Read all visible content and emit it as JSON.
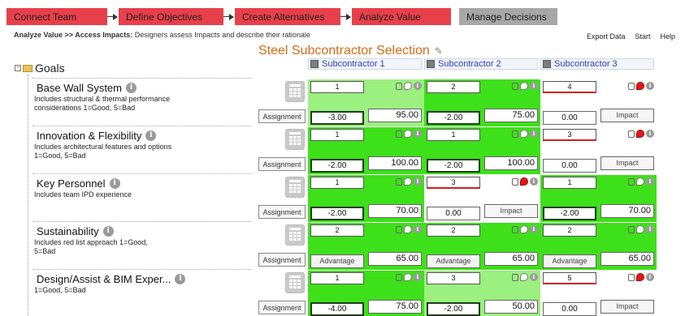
{
  "workflow": {
    "steps": [
      {
        "label": "Connect Team",
        "state": "active"
      },
      {
        "label": "Define Objectives",
        "state": "active"
      },
      {
        "label": "Create Alternatives",
        "state": "active"
      },
      {
        "label": "Analyze Value",
        "state": "active"
      },
      {
        "label": "Manage Decisions",
        "state": "inactive"
      }
    ]
  },
  "breadcrumb": {
    "path": "Analyze Value >> Access Impacts:",
    "description": "Designers assess Impacts and describe their rationale"
  },
  "top_links": [
    "Export Data",
    "Start",
    "Help"
  ],
  "title": "Steel Subcontractor Selection",
  "subcontractors": [
    "Subcontractor 1",
    "Subcontractor 2",
    "Subcontractor 3"
  ],
  "goals_header": "Goals",
  "assignment_label": "Assignment",
  "colors": {
    "accent_orange": "#d56b17",
    "step_red": "#e8404b",
    "green": "#3ee01a",
    "light_green": "#9bf07f",
    "link_blue": "#2b3fb5"
  },
  "goals": [
    {
      "name": "Base Wall System",
      "description": [
        "Includes structural & thermal performance",
        "considerations  1=Good, 5=Bad"
      ],
      "cells": [
        {
          "rank": "1",
          "score": "-3.00",
          "value": "95.00",
          "bg": "lightgreen"
        },
        {
          "rank": "2",
          "score": "-2.00",
          "value": "75.00",
          "bg": "green"
        },
        {
          "rank": "4",
          "score": "0.00",
          "value": "Impact",
          "bg": "white"
        }
      ]
    },
    {
      "name": "Innovation & Flexibility",
      "description": [
        "Includes architectural features and options",
        "1=Good, 5=Bad"
      ],
      "cells": [
        {
          "rank": "1",
          "score": "-2.00",
          "value": "100.00",
          "bg": "green"
        },
        {
          "rank": "1",
          "score": "-2.00",
          "value": "100.00",
          "bg": "green"
        },
        {
          "rank": "3",
          "score": "0.00",
          "value": "Impact",
          "bg": "white"
        }
      ]
    },
    {
      "name": "Key Personnel",
      "description": [
        "Includes team IPD experience"
      ],
      "cells": [
        {
          "rank": "1",
          "score": "-2.00",
          "value": "70.00",
          "bg": "green"
        },
        {
          "rank": "3",
          "score": "0.00",
          "value": "Impact",
          "bg": "white"
        },
        {
          "rank": "1",
          "score": "-2.00",
          "value": "70.00",
          "bg": "green"
        }
      ]
    },
    {
      "name": "Sustainability",
      "description": [
        "Includes red list approach   1=Good,",
        "5=Bad"
      ],
      "cells": [
        {
          "rank": "2",
          "score": "Advantage",
          "value": "65.00",
          "bg": "green"
        },
        {
          "rank": "2",
          "score": "Advantage",
          "value": "65.00",
          "bg": "green"
        },
        {
          "rank": "2",
          "score": "Advantage",
          "value": "65.00",
          "bg": "green"
        }
      ]
    },
    {
      "name": "Design/Assist & BIM Exper...",
      "description": [
        "1=Good, 5=Bad"
      ],
      "cells": [
        {
          "rank": "1",
          "score": "-4.00",
          "value": "75.00",
          "bg": "green"
        },
        {
          "rank": "3",
          "score": "-2.00",
          "value": "50.00",
          "bg": "lightgreen"
        },
        {
          "rank": "5",
          "score": "0.00",
          "value": "Impact",
          "bg": "white"
        }
      ]
    }
  ]
}
